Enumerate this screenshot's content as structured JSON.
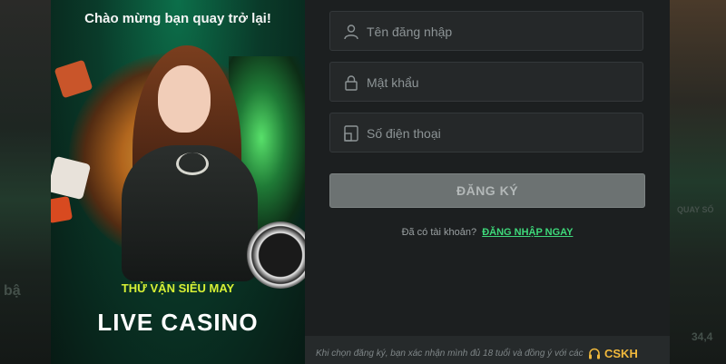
{
  "banner": {
    "welcome": "Chào mừng bạn quay trở lại!",
    "promo": "THỬ VẬN SIÊU MAY",
    "title": "LIVE CASINO"
  },
  "form": {
    "username_placeholder": "Tên đăng nhập",
    "password_placeholder": "Mật khẩu",
    "phone_placeholder": "Số điện thoại",
    "submit_label": "ĐĂNG KÝ",
    "have_account": "Đã có tài khoản?",
    "login_link": "ĐĂNG NHẬP NGAY"
  },
  "footer": {
    "terms": "Khi chọn đăng ký, bạn xác nhận mình đủ 18 tuổi và đồng ý với các",
    "support": "CSKH"
  },
  "background": {
    "left_text": "bậ",
    "right_text_top": "QUAY SỐ",
    "right_text_bottom": "34,4"
  },
  "icons": {
    "username": "user-icon",
    "password": "lock-icon",
    "phone": "phone-icon",
    "support": "headset-icon"
  },
  "colors": {
    "accent_green": "#3ed87a",
    "promo_yellow": "#d7f035",
    "support_orange": "#f0b83c",
    "button_gray": "#6c7272"
  }
}
